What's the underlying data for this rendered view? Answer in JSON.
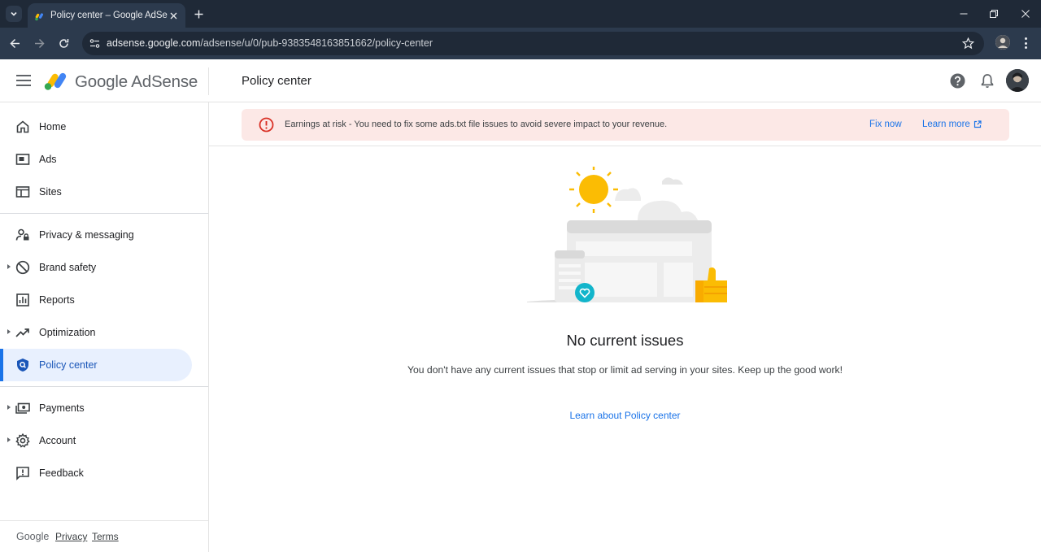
{
  "browser": {
    "tab_title": "Policy center – Google AdSense",
    "url_host": "adsense.google.com",
    "url_path": "/adsense/u/0/pub-9383548163851662/policy-center"
  },
  "header": {
    "brand": "Google AdSense",
    "page_title": "Policy center"
  },
  "sidebar": {
    "items": [
      {
        "label": "Home",
        "icon": "home-icon"
      },
      {
        "label": "Ads",
        "icon": "ads-icon"
      },
      {
        "label": "Sites",
        "icon": "sites-icon"
      },
      {
        "label": "Privacy & messaging",
        "icon": "privacy-icon"
      },
      {
        "label": "Brand safety",
        "icon": "block-icon"
      },
      {
        "label": "Reports",
        "icon": "bar-chart-icon"
      },
      {
        "label": "Optimization",
        "icon": "trending-up-icon"
      },
      {
        "label": "Policy center",
        "icon": "shield-search-icon"
      },
      {
        "label": "Payments",
        "icon": "payments-icon"
      },
      {
        "label": "Account",
        "icon": "gear-icon"
      },
      {
        "label": "Feedback",
        "icon": "feedback-icon"
      }
    ],
    "footer": {
      "google": "Google",
      "privacy": "Privacy",
      "terms": "Terms"
    }
  },
  "alert": {
    "message": "Earnings at risk - You need to fix some ads.txt file issues to avoid severe impact to your revenue.",
    "fix_label": "Fix now",
    "learn_label": "Learn more"
  },
  "empty_state": {
    "title": "No current issues",
    "description": "You don't have any current issues that stop or limit ad serving in your sites. Keep up the good work!",
    "link": "Learn about Policy center"
  },
  "colors": {
    "accent": "#1a73e8",
    "alert_bg": "#fce8e6",
    "error": "#d93025",
    "active_nav_bg": "#e8f0fe"
  }
}
